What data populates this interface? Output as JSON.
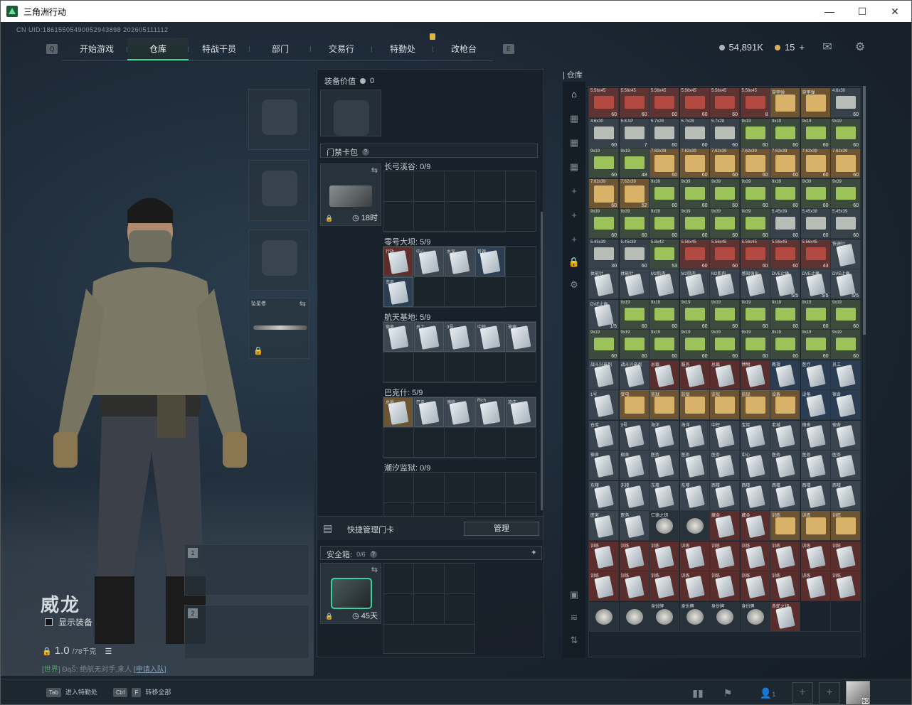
{
  "window": {
    "title": "三角洲行动",
    "minimize": "—",
    "maximize": "☐",
    "close": "✕"
  },
  "uid": "CN UID:18615505490052943898 202605111112",
  "nav": {
    "tabs": [
      "开始游戏",
      "仓库",
      "特战干员",
      "部门",
      "交易行",
      "特勤处",
      "改枪台"
    ],
    "active": "仓库",
    "left_key": "Q",
    "right_key": "E"
  },
  "currency": {
    "silver": "54,891K",
    "gold": "15",
    "gold_plus": "+"
  },
  "character": {
    "name": "威龙",
    "show_gear": "显示装备",
    "weight": "1.0",
    "weight_max": "/78千克"
  },
  "chat": {
    "channel": "[世界]",
    "user": "ĐąŠ:",
    "message": "绝航无对手,来人",
    "link": "[申请入队]"
  },
  "loadout": {
    "weapon1": "1",
    "weapon2": "2",
    "melee_label": "坠星者"
  },
  "equipment": {
    "value_label": "装备价值",
    "value": "0"
  },
  "keycard": {
    "title": "门禁卡包",
    "timer": "18时",
    "sections": [
      {
        "name": "长弓溪谷: 0/9"
      },
      {
        "name": "零号大坝: 5/9",
        "cards": [
          "行政",
          "中心",
          "水泥",
          "管理",
          "变电"
        ]
      },
      {
        "name": "航天基地: 5/9",
        "cards": [
          "宿舍",
          "员工",
          "3号",
          "中控",
          "玻璃"
        ]
      },
      {
        "name": "巴克什: 5/9",
        "cards": [
          "总裁",
          "巴克",
          "博物",
          "Rich",
          "旅店"
        ]
      },
      {
        "name": "潮汐监狱: 0/9"
      }
    ],
    "quick_label": "快捷管理门卡",
    "manage": "管理"
  },
  "safebox": {
    "title": "安全箱:",
    "count": "0/6",
    "timer": "45天"
  },
  "stash": {
    "label": "仓库",
    "rows": [
      [
        [
          "5.56x45",
          "60",
          "ammo-red"
        ],
        [
          "5.56x45",
          "60",
          "ammo-red"
        ],
        [
          "5.56x45",
          "60",
          "ammo-red"
        ],
        [
          "5.56x45",
          "60",
          "ammo-red"
        ],
        [
          "5.56x45",
          "60",
          "ammo-red"
        ],
        [
          "5.56x45",
          "8",
          "ammo-red"
        ],
        [
          "穿甲弹",
          "",
          "gold"
        ],
        [
          "穿甲弹",
          "",
          "gold"
        ],
        [
          "4.6x30",
          "60",
          "ammo"
        ]
      ],
      [
        [
          "4.6x30",
          "60",
          "ammo"
        ],
        [
          "5.8 AP",
          "7",
          "ammo"
        ],
        [
          "5.7x28",
          "60",
          "ammo"
        ],
        [
          "5.7x28",
          "60",
          "ammo"
        ],
        [
          "5.7x28",
          "60",
          "ammo"
        ],
        [
          "9x19",
          "60",
          "ammo-grn"
        ],
        [
          "9x19",
          "60",
          "ammo-grn"
        ],
        [
          "9x19",
          "60",
          "ammo-grn"
        ],
        [
          "9x19",
          "60",
          "ammo-grn"
        ]
      ],
      [
        [
          "9x19",
          "60",
          "ammo-grn"
        ],
        [
          "9x19",
          "48",
          "ammo-grn"
        ],
        [
          "7.62x39",
          "60",
          "gold"
        ],
        [
          "7.62x39",
          "60",
          "gold"
        ],
        [
          "7.62x39",
          "60",
          "gold"
        ],
        [
          "7.62x39",
          "60",
          "gold"
        ],
        [
          "7.62x39",
          "60",
          "gold"
        ],
        [
          "7.62x39",
          "60",
          "gold"
        ],
        [
          "7.62x39",
          "60",
          "gold"
        ]
      ],
      [
        [
          "7.62x39",
          "60",
          "gold"
        ],
        [
          "7.62x39",
          "52",
          "gold"
        ],
        [
          "9x39",
          "60",
          "ammo-grn"
        ],
        [
          "9x39",
          "60",
          "ammo-grn"
        ],
        [
          "9x39",
          "60",
          "ammo-grn"
        ],
        [
          "9x39",
          "60",
          "ammo-grn"
        ],
        [
          "9x39",
          "60",
          "ammo-grn"
        ],
        [
          "9x39",
          "60",
          "ammo-grn"
        ],
        [
          "9x39",
          "60",
          "ammo-grn"
        ]
      ],
      [
        [
          "9x39",
          "60",
          "ammo-grn"
        ],
        [
          "9x39",
          "60",
          "ammo-grn"
        ],
        [
          "9x39",
          "60",
          "ammo-grn"
        ],
        [
          "9x39",
          "60",
          "ammo-grn"
        ],
        [
          "9x39",
          "60",
          "ammo-grn"
        ],
        [
          "9x39",
          "60",
          "ammo-grn"
        ],
        [
          "5.45x39",
          "60",
          "ammo"
        ],
        [
          "5.45x39",
          "60",
          "ammo"
        ],
        [
          "5.45x39",
          "60",
          "ammo"
        ]
      ],
      [
        [
          "5.45x39",
          "30",
          "ammo"
        ],
        [
          "5.45x39",
          "60",
          "ammo"
        ],
        [
          "5.8x42",
          "53",
          "ammo-grn"
        ],
        [
          "5.56x45",
          "60",
          "ammo-red"
        ],
        [
          "5.56x45",
          "60",
          "ammo-red"
        ],
        [
          "5.56x45",
          "60",
          "ammo-red"
        ],
        [
          "5.56x45",
          "60",
          "ammo-red"
        ],
        [
          "5.56x45",
          "43",
          "ammo-red"
        ],
        [
          "快速针",
          "",
          "card-gry"
        ]
      ],
      [
        [
          "体能针",
          "",
          "card-gry"
        ],
        [
          "体能针",
          "",
          "card-gry"
        ],
        [
          "M2肌肉",
          "",
          "card-gry"
        ],
        [
          "M2肌肉",
          "",
          "card-gry"
        ],
        [
          "M2肌肉",
          "",
          "card-gry"
        ],
        [
          "感知强化",
          "",
          "card-gry"
        ],
        [
          "DVE止痛",
          "5/5",
          "card-gry"
        ],
        [
          "DVE止痛",
          "5/5",
          "card-gry"
        ],
        [
          "DVE止痛",
          "5/5",
          "card-gry"
        ]
      ],
      [
        [
          "DVE止痛",
          "1/5",
          "card-gry"
        ],
        [
          "9x19",
          "60",
          "ammo-grn"
        ],
        [
          "9x19",
          "60",
          "ammo-grn"
        ],
        [
          "9x19",
          "60",
          "ammo-grn"
        ],
        [
          "9x19",
          "60",
          "ammo-grn"
        ],
        [
          "9x19",
          "60",
          "ammo-grn"
        ],
        [
          "9x19",
          "60",
          "ammo-grn"
        ],
        [
          "9x19",
          "60",
          "ammo-grn"
        ],
        [
          "9x19",
          "60",
          "ammo-grn"
        ]
      ],
      [
        [
          "9x19",
          "60",
          "ammo-grn"
        ],
        [
          "9x19",
          "60",
          "ammo-grn"
        ],
        [
          "9x19",
          "60",
          "ammo-grn"
        ],
        [
          "9x19",
          "60",
          "ammo-grn"
        ],
        [
          "9x19",
          "60",
          "ammo-grn"
        ],
        [
          "9x19",
          "60",
          "ammo-grn"
        ],
        [
          "9x19",
          "60",
          "ammo-grn"
        ],
        [
          "9x19",
          "60",
          "ammo-grn"
        ],
        [
          "9x19",
          "60",
          "ammo-grn"
        ]
      ],
      [
        [
          "战斗兴奋剂",
          "",
          "card-gry"
        ],
        [
          "战斗兴奋剂",
          "",
          "card-gry"
        ],
        [
          "总裁",
          "",
          "card-red"
        ],
        [
          "服务",
          "",
          "card-red"
        ],
        [
          "总裁",
          "",
          "card-red"
        ],
        [
          "博物",
          "",
          "card-red"
        ],
        [
          "教授",
          "",
          "card-blu"
        ],
        [
          "医疗",
          "",
          "card-blu"
        ],
        [
          "员工",
          "",
          "card-blu"
        ]
      ],
      [
        [
          "1号",
          "",
          "card-gry"
        ],
        [
          "变电",
          "",
          "gold"
        ],
        [
          "监狱",
          "",
          "gold"
        ],
        [
          "监狱",
          "",
          "gold"
        ],
        [
          "监狱",
          "",
          "gold"
        ],
        [
          "监狱",
          "",
          "gold"
        ],
        [
          "设备",
          "",
          "gold"
        ],
        [
          "设备",
          "",
          "card-blu"
        ],
        [
          "宿舍",
          "",
          "card-blu"
        ]
      ],
      [
        [
          "仓库",
          "",
          "card-gry"
        ],
        [
          "3号",
          "",
          "card-gry"
        ],
        [
          "海洋",
          "",
          "card-gry"
        ],
        [
          "海洋",
          "",
          "card-gry"
        ],
        [
          "中控",
          "",
          "card-gry"
        ],
        [
          "宝库",
          "",
          "card-gry"
        ],
        [
          "老城",
          "",
          "card-gry"
        ],
        [
          "宿舍",
          "",
          "card-gry"
        ],
        [
          "宿舍",
          "",
          "card-gry"
        ]
      ],
      [
        [
          "宿舍",
          "",
          "card-gry"
        ],
        [
          "宿舍",
          "",
          "card-gry"
        ],
        [
          "医务",
          "",
          "card-gry"
        ],
        [
          "医务",
          "",
          "card-gry"
        ],
        [
          "医务",
          "",
          "card-gry"
        ],
        [
          "中心",
          "",
          "card-gry"
        ],
        [
          "医务",
          "",
          "card-gry"
        ],
        [
          "医务",
          "",
          "card-gry"
        ],
        [
          "医务",
          "",
          "card-gry"
        ]
      ],
      [
        [
          "东楼",
          "",
          "card-gry"
        ],
        [
          "东楼",
          "",
          "card-gry"
        ],
        [
          "东楼",
          "",
          "card-gry"
        ],
        [
          "东楼",
          "",
          "card-gry"
        ],
        [
          "西楼",
          "",
          "card-gry"
        ],
        [
          "西楼",
          "",
          "card-gry"
        ],
        [
          "西楼",
          "",
          "card-gry"
        ],
        [
          "西楼",
          "",
          "card-gry"
        ],
        [
          "西楼",
          "",
          "card-gry"
        ]
      ],
      [
        [
          "医务",
          "",
          "card-gry"
        ],
        [
          "医务",
          "",
          "card-gry"
        ],
        [
          "仁德之钥",
          "",
          "dark"
        ],
        [
          "",
          "",
          "dark"
        ],
        [
          "藏金",
          "",
          "card-red"
        ],
        [
          "藏金",
          "",
          "card-red"
        ],
        [
          "训练",
          "",
          "gold"
        ],
        [
          "训练",
          "",
          "gold"
        ],
        [
          "训练",
          "",
          "gold"
        ]
      ],
      [
        [
          "训练",
          "",
          "card-red"
        ],
        [
          "训练",
          "",
          "card-red"
        ],
        [
          "训练",
          "",
          "card-red"
        ],
        [
          "训练",
          "",
          "card-red"
        ],
        [
          "训练",
          "",
          "card-red"
        ],
        [
          "训练",
          "",
          "card-red"
        ],
        [
          "训练",
          "",
          "card-red"
        ],
        [
          "训练",
          "",
          "card-red"
        ],
        [
          "训练",
          "",
          "card-red"
        ]
      ],
      [
        [
          "训练",
          "",
          "card-red"
        ],
        [
          "训练",
          "",
          "card-red"
        ],
        [
          "训练",
          "",
          "card-red"
        ],
        [
          "训练",
          "",
          "card-red"
        ],
        [
          "训练",
          "",
          "card-red"
        ],
        [
          "训练",
          "",
          "card-red"
        ],
        [
          "训练",
          "",
          "card-red"
        ],
        [
          "训练",
          "",
          "card-red"
        ],
        [
          "训练",
          "",
          "card-red"
        ]
      ],
      [
        [
          "",
          "",
          "dark"
        ],
        [
          "",
          "",
          "dark"
        ],
        [
          "身份牌",
          "",
          "dark"
        ],
        [
          "身份牌",
          "",
          "dark"
        ],
        [
          "身份牌",
          "",
          "dark"
        ],
        [
          "身份牌",
          "",
          "dark"
        ],
        [
          "赤蛇之钥",
          "",
          "card-red"
        ],
        [
          "",
          "",
          "empty"
        ],
        [
          "",
          "",
          "empty"
        ]
      ]
    ]
  },
  "bottom": {
    "tab_key": "Tab",
    "tab_label": "进入特勤处",
    "ctrl_key": "Ctrl",
    "f_key": "F",
    "ctrl_label": "转移全部",
    "friends_count": "1",
    "avatar_level": "60"
  }
}
